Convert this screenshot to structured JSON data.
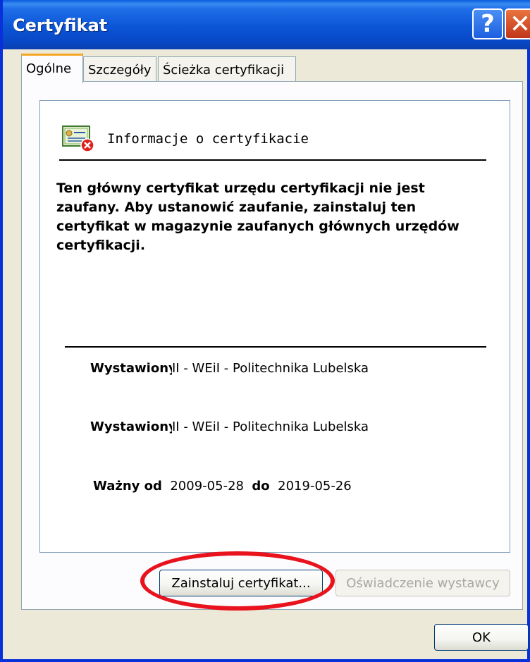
{
  "window": {
    "title": "Certyfikat"
  },
  "titlebar_buttons": {
    "help": "?",
    "close": "✕"
  },
  "tabs": [
    {
      "label": "Ogólne",
      "active": true
    },
    {
      "label": "Szczegóły",
      "active": false
    },
    {
      "label": "Ścieżka certyfikacji",
      "active": false
    }
  ],
  "info": {
    "icon": "certificate-error-icon",
    "title": "Informacje o certyfikacie",
    "warning": "Ten główny certyfikat urzędu certyfikacji nie jest zaufany. Aby ustanowić zaufanie, zainstaluj ten certyfikat w magazynie zaufanych głównych urzędów certyfikacji."
  },
  "fields": {
    "issued_to_label": "Wystawiony",
    "issued_to_value": "II - WEiI - Politechnika Lubelska",
    "issued_by_label": "Wystawiony",
    "issued_by_value": "II - WEiI - Politechnika Lubelska",
    "valid_from_label": "Ważny od",
    "valid_from_value": "2009-05-28",
    "valid_to_label": "do",
    "valid_to_value": "2019-05-26"
  },
  "buttons": {
    "install": "Zainstaluj certyfikat...",
    "issuer_statement": "Oświadczenie wystawcy",
    "ok": "OK"
  },
  "colors": {
    "annotation": "#e8131c",
    "titlebar": "#0b55d6"
  }
}
